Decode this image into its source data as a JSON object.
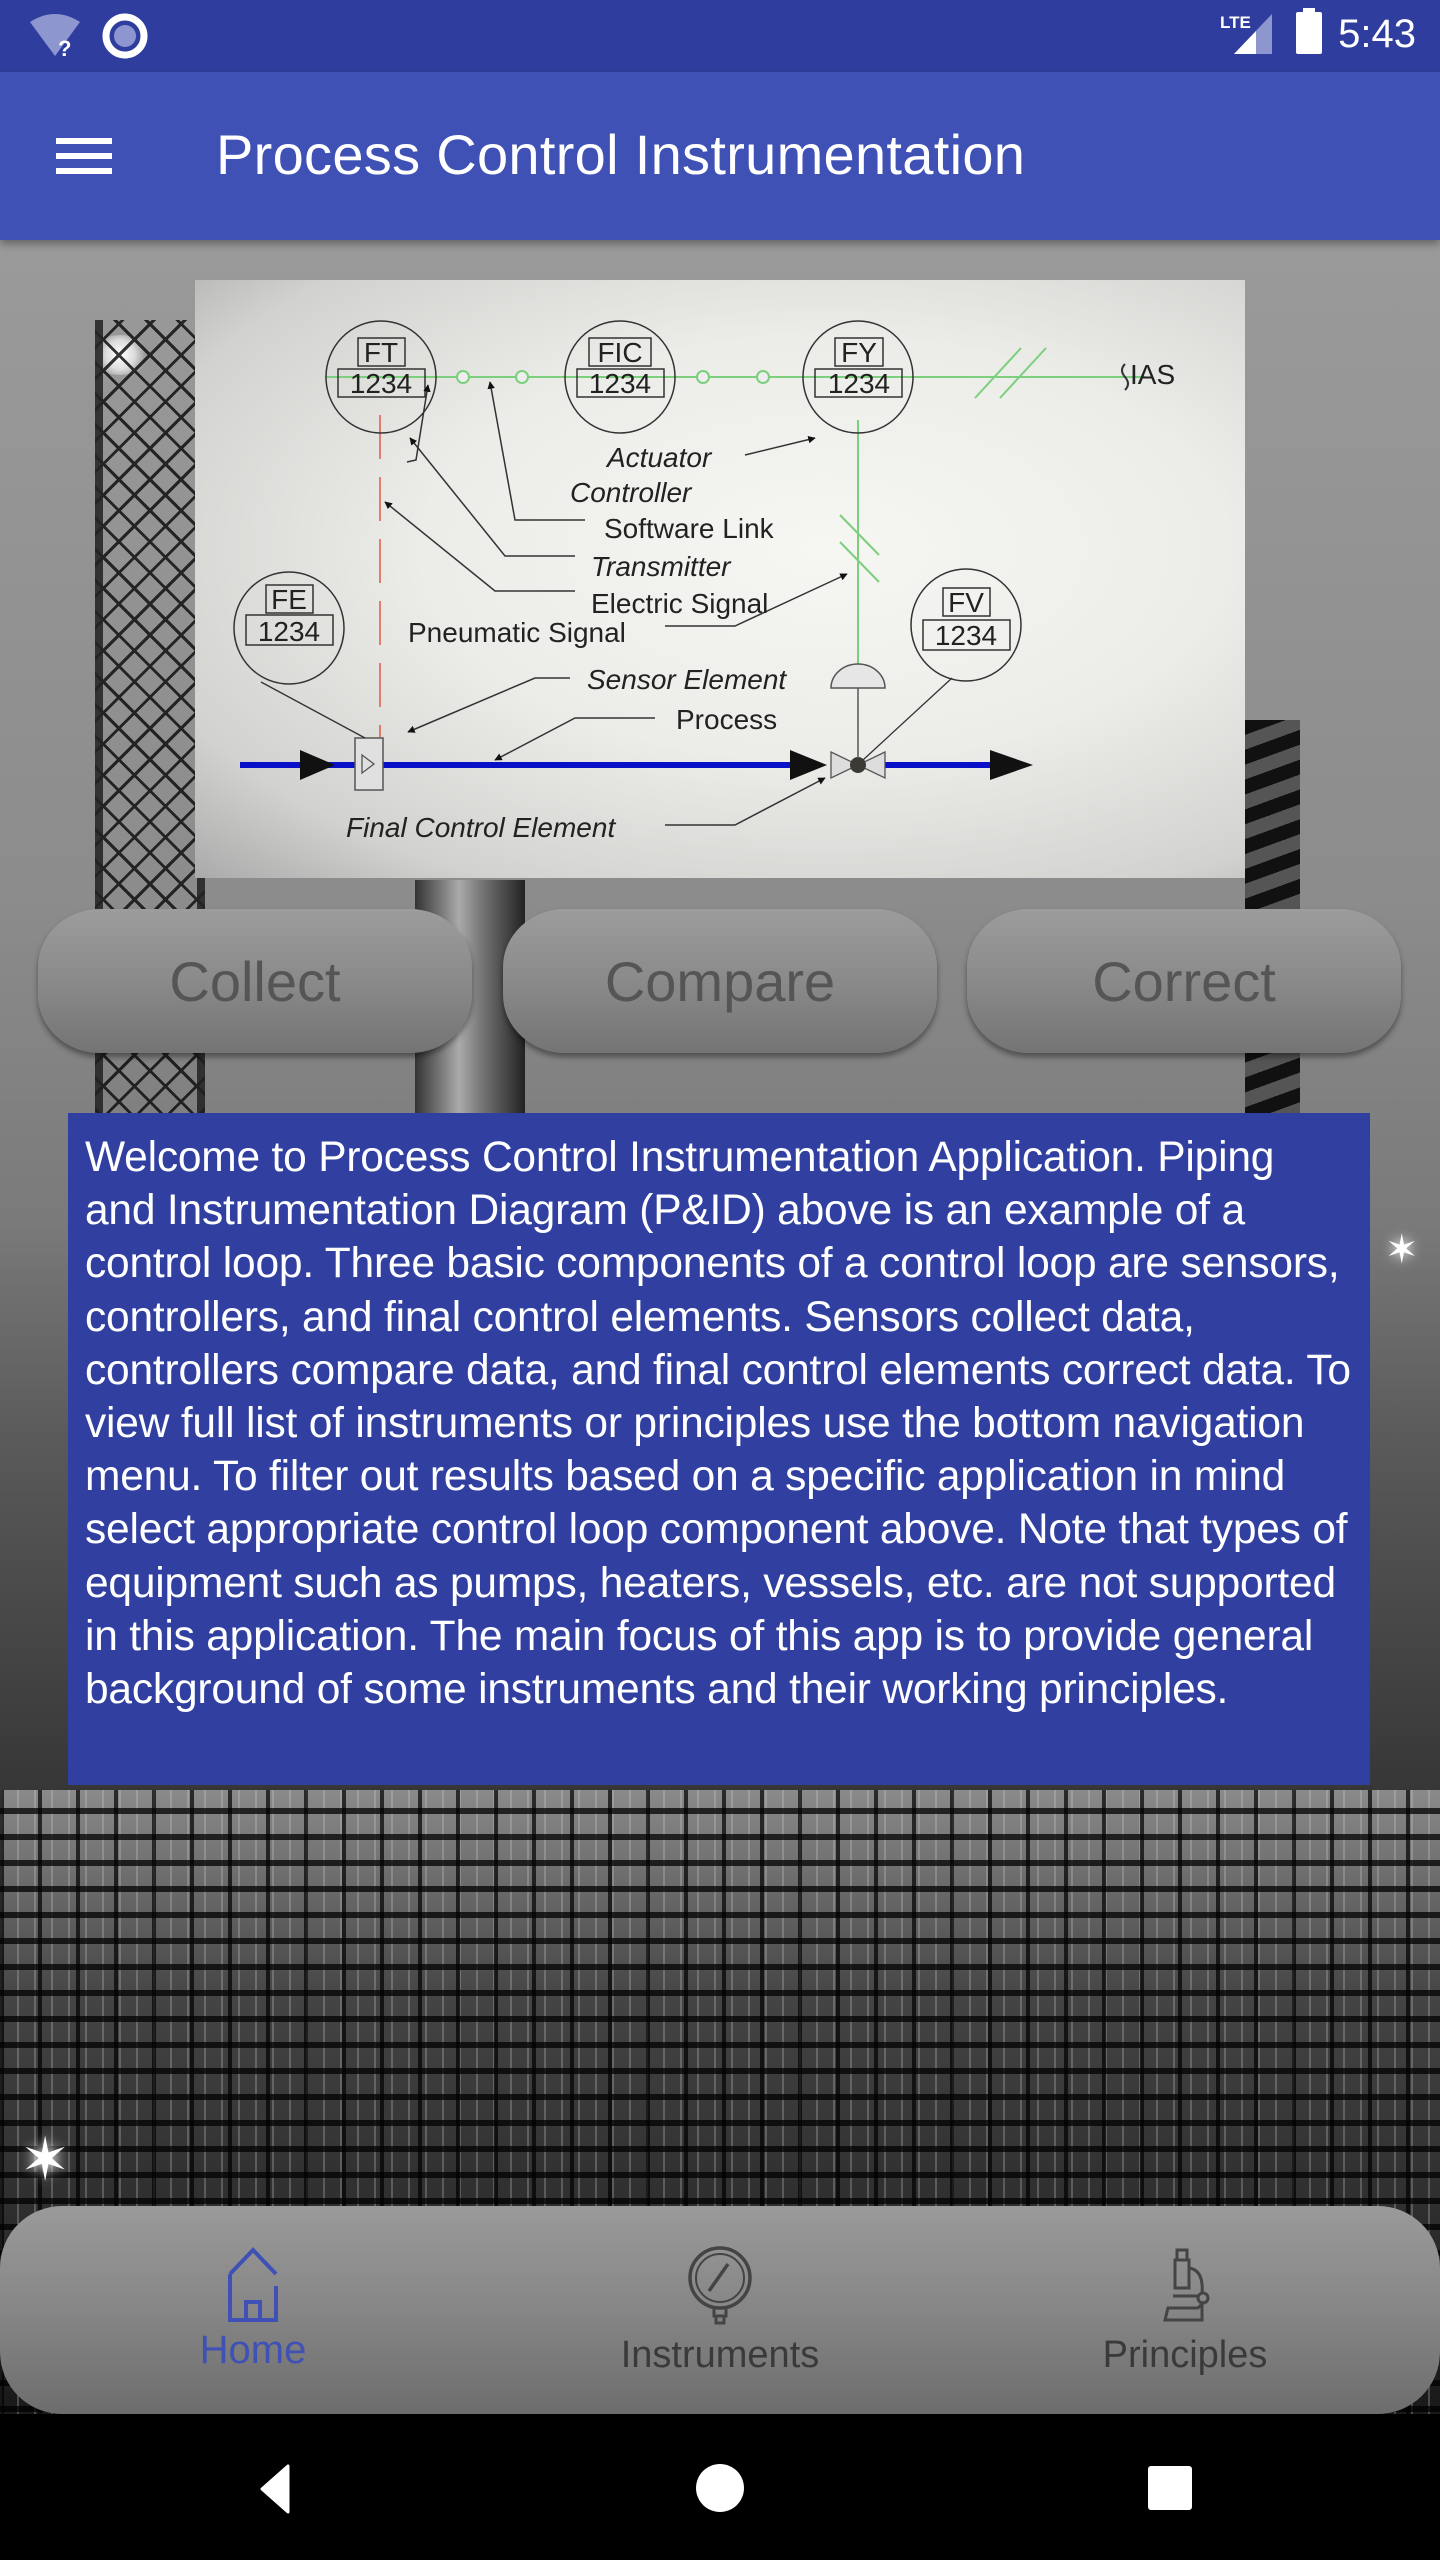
{
  "status_bar": {
    "time": "5:43",
    "network_label": "LTE",
    "icons": [
      "wifi-unknown-icon",
      "sync-circle-icon",
      "lte-signal-icon",
      "battery-icon"
    ]
  },
  "app_bar": {
    "title": "Process Control Instrumentation",
    "menu_icon": "hamburger-menu-icon"
  },
  "diagram": {
    "instruments": [
      {
        "tag": "FT",
        "number": "1234"
      },
      {
        "tag": "FIC",
        "number": "1234"
      },
      {
        "tag": "FY",
        "number": "1234"
      },
      {
        "tag": "FE",
        "number": "1234"
      },
      {
        "tag": "FV",
        "number": "1234"
      }
    ],
    "system_label": "IAS",
    "labels": {
      "actuator": "Actuator",
      "controller": "Controller",
      "software_link": "Software Link",
      "transmitter": "Transmitter",
      "electric_signal": "Electric Signal",
      "pneumatic_signal": "Pneumatic Signal",
      "sensor_element": "Sensor Element",
      "process": "Process",
      "final_control_element": "Final Control Element"
    },
    "colors": {
      "process_line": "#0a10c8",
      "software_link": "#7ccf7c",
      "electric_signal": "#e05a4a"
    }
  },
  "filters": [
    {
      "label": "Collect"
    },
    {
      "label": "Compare"
    },
    {
      "label": "Correct"
    }
  ],
  "info": {
    "text": "Welcome to Process Control Instrumentation Application. Piping and Instrumentation Diagram (P&ID) above is an example of a control loop. Three basic components of a control loop are sensors, controllers, and final control elements. Sensors collect data, controllers compare data, and final control elements correct data. To view full list of instruments or principles use the bottom navigation menu. To filter out results based on a specific application in mind select appropriate control loop component above. Note that types of equipment such as pumps, heaters, vessels, etc. are not supported in this application. The main focus of this app is to provide general background of some instruments and their working principles."
  },
  "bottom_nav": {
    "items": [
      {
        "label": "Home",
        "icon": "home-icon",
        "active": true
      },
      {
        "label": "Instruments",
        "icon": "pressure-gauge-icon",
        "active": false
      },
      {
        "label": "Principles",
        "icon": "microscope-icon",
        "active": false
      }
    ],
    "active_color": "#3f51b5"
  },
  "system_nav": {
    "buttons": [
      "back",
      "home",
      "recents"
    ]
  },
  "theme": {
    "primary": "#3f51b5",
    "primary_dark": "#2f3e9e",
    "info_panel": "#3140a0"
  }
}
